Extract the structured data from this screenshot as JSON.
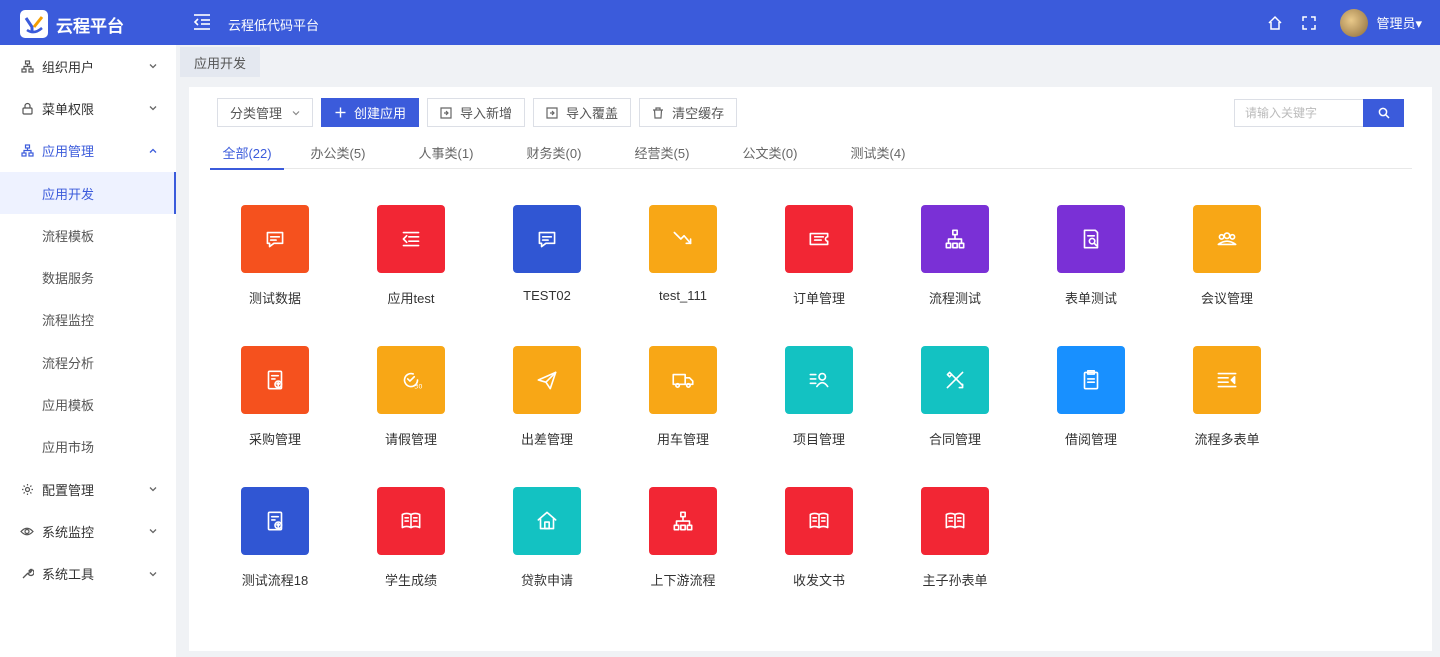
{
  "app": {
    "logo_text": "云程平台",
    "platform_title": "云程低代码平台",
    "user_name": "管理员"
  },
  "sidebar": {
    "items": [
      {
        "label": "组织用户",
        "icon": "org-icon",
        "expanded": false
      },
      {
        "label": "菜单权限",
        "icon": "lock-icon",
        "expanded": false
      },
      {
        "label": "应用管理",
        "icon": "apps-icon",
        "expanded": true,
        "children": [
          {
            "label": "应用开发",
            "active": true
          },
          {
            "label": "流程模板"
          },
          {
            "label": "数据服务"
          },
          {
            "label": "流程监控"
          },
          {
            "label": "流程分析"
          },
          {
            "label": "应用模板"
          },
          {
            "label": "应用市场"
          }
        ]
      },
      {
        "label": "配置管理",
        "icon": "gear-icon",
        "expanded": false
      },
      {
        "label": "系统监控",
        "icon": "eye-icon",
        "expanded": false
      },
      {
        "label": "系统工具",
        "icon": "wrench-icon",
        "expanded": false
      }
    ]
  },
  "tagbar": {
    "active_tag": "应用开发"
  },
  "toolbar": {
    "category_label": "分类管理",
    "create_label": "创建应用",
    "import_new_label": "导入新增",
    "import_overwrite_label": "导入覆盖",
    "clear_cache_label": "清空缓存"
  },
  "search": {
    "placeholder": "请输入关键字"
  },
  "tabs": [
    {
      "label": "全部(22)",
      "active": true
    },
    {
      "label": "办公类(5)"
    },
    {
      "label": "人事类(1)"
    },
    {
      "label": "财务类(0)"
    },
    {
      "label": "经营类(5)"
    },
    {
      "label": "公文类(0)"
    },
    {
      "label": "测试类(4)"
    }
  ],
  "apps": [
    {
      "label": "测试数据",
      "color": "#f5511e",
      "icon": "message-icon"
    },
    {
      "label": "应用test",
      "color": "#f22634",
      "icon": "indent-icon"
    },
    {
      "label": "TEST02",
      "color": "#3056d3",
      "icon": "message-icon"
    },
    {
      "label": "test_111",
      "color": "#f8a716",
      "icon": "trend-down-icon"
    },
    {
      "label": "订单管理",
      "color": "#f22634",
      "icon": "ticket-icon"
    },
    {
      "label": "流程测试",
      "color": "#7a30d6",
      "icon": "hierarchy-icon"
    },
    {
      "label": "表单测试",
      "color": "#7a30d6",
      "icon": "doc-search-icon"
    },
    {
      "label": "会议管理",
      "color": "#f8a716",
      "icon": "group-icon"
    },
    {
      "label": "采购管理",
      "color": "#f5511e",
      "icon": "form-upload-icon"
    },
    {
      "label": "请假管理",
      "color": "#f8a716",
      "icon": "clock-30-icon"
    },
    {
      "label": "出差管理",
      "color": "#f8a716",
      "icon": "send-icon"
    },
    {
      "label": "用车管理",
      "color": "#f8a716",
      "icon": "truck-icon"
    },
    {
      "label": "项目管理",
      "color": "#13c2c2",
      "icon": "person-list-icon"
    },
    {
      "label": "合同管理",
      "color": "#13c2c2",
      "icon": "pen-ruler-icon"
    },
    {
      "label": "借阅管理",
      "color": "#1890ff",
      "icon": "clipboard-icon"
    },
    {
      "label": "流程多表单",
      "color": "#f8a716",
      "icon": "list-arrow-icon"
    },
    {
      "label": "测试流程18",
      "color": "#3056d3",
      "icon": "form-upload-icon"
    },
    {
      "label": "学生成绩",
      "color": "#f22634",
      "icon": "book-icon"
    },
    {
      "label": "贷款申请",
      "color": "#13c2c2",
      "icon": "home-icon"
    },
    {
      "label": "上下游流程",
      "color": "#f22634",
      "icon": "hierarchy-icon"
    },
    {
      "label": "收发文书",
      "color": "#f22634",
      "icon": "book-icon"
    },
    {
      "label": "主子孙表单",
      "color": "#f22634",
      "icon": "book-icon"
    }
  ]
}
